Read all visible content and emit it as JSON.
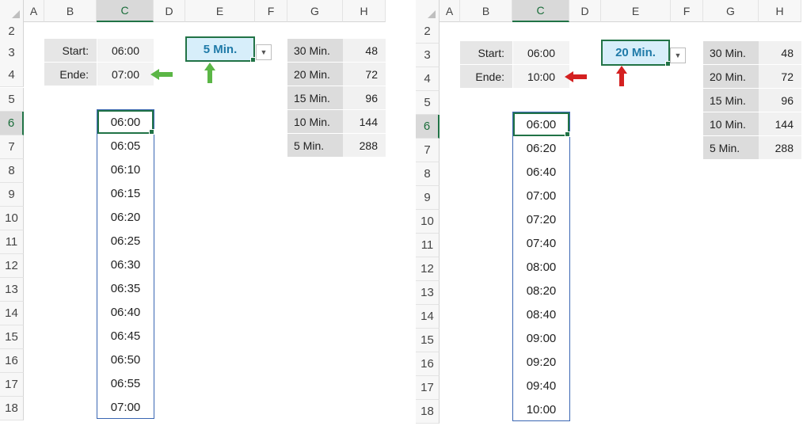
{
  "columns": [
    "A",
    "B",
    "C",
    "D",
    "E",
    "F",
    "G",
    "H"
  ],
  "rows": [
    "2",
    "3",
    "4",
    "5",
    "6",
    "7",
    "8",
    "9",
    "10",
    "11",
    "12",
    "13",
    "14",
    "15",
    "16",
    "17",
    "18"
  ],
  "accent": "#217346",
  "left": {
    "start_label": "Start:",
    "start_value": "06:00",
    "end_label": "Ende:",
    "end_value": "07:00",
    "interval_selected": "5 Min.",
    "arrow_color": "#5bb646",
    "times": [
      "06:00",
      "06:05",
      "06:10",
      "06:15",
      "06:20",
      "06:25",
      "06:30",
      "06:35",
      "06:40",
      "06:45",
      "06:50",
      "06:55",
      "07:00"
    ]
  },
  "right": {
    "start_label": "Start:",
    "start_value": "06:00",
    "end_label": "Ende:",
    "end_value": "10:00",
    "interval_selected": "20 Min.",
    "arrow_color": "#d42020",
    "times": [
      "06:00",
      "06:20",
      "06:40",
      "07:00",
      "07:20",
      "07:40",
      "08:00",
      "08:20",
      "08:40",
      "09:00",
      "09:20",
      "09:40",
      "10:00"
    ]
  },
  "interval_table": [
    {
      "label": "30 Min.",
      "count": "48"
    },
    {
      "label": "20 Min.",
      "count": "72"
    },
    {
      "label": "15 Min.",
      "count": "96"
    },
    {
      "label": "10 Min.",
      "count": "144"
    },
    {
      "label": "5 Min.",
      "count": "288"
    }
  ]
}
